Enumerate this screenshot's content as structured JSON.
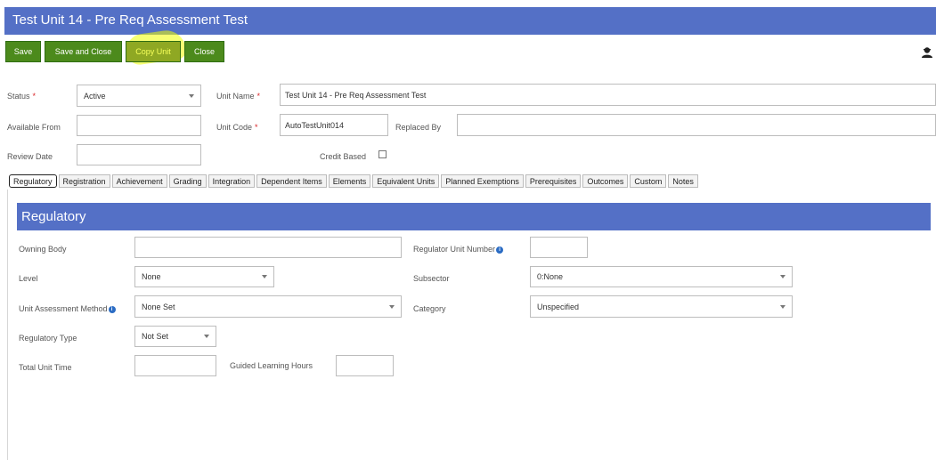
{
  "window": {
    "title": "Test Unit 14 - Pre Req Assessment Test"
  },
  "toolbar": {
    "save": "Save",
    "save_and_close": "Save and Close",
    "copy_unit": "Copy Unit",
    "close": "Close"
  },
  "header_form": {
    "status_label": "Status",
    "status_value": "Active",
    "unit_name_label": "Unit Name",
    "unit_name_value": "Test Unit 14 - Pre Req Assessment Test",
    "available_from_label": "Available From",
    "available_from_value": "",
    "unit_code_label": "Unit Code",
    "unit_code_value": "AutoTestUnit014",
    "replaced_by_label": "Replaced By",
    "replaced_by_value": "",
    "review_date_label": "Review Date",
    "review_date_value": "",
    "credit_based_label": "Credit Based",
    "credit_based_checked": false,
    "required_marker": "*"
  },
  "tabs": [
    {
      "label": "Regulatory",
      "active": true
    },
    {
      "label": "Registration"
    },
    {
      "label": "Achievement"
    },
    {
      "label": "Grading"
    },
    {
      "label": "Integration"
    },
    {
      "label": "Dependent Items"
    },
    {
      "label": "Elements"
    },
    {
      "label": "Equivalent Units"
    },
    {
      "label": "Planned Exemptions"
    },
    {
      "label": "Prerequisites"
    },
    {
      "label": "Outcomes"
    },
    {
      "label": "Custom"
    },
    {
      "label": "Notes"
    }
  ],
  "regulatory": {
    "title": "Regulatory",
    "owning_body_label": "Owning Body",
    "owning_body_value": "",
    "regulator_unit_number_label": "Regulator Unit Number",
    "regulator_unit_number_value": "",
    "level_label": "Level",
    "level_value": "None",
    "subsector_label": "Subsector",
    "subsector_value": "0:None",
    "unit_assessment_method_label": "Unit Assessment Method",
    "unit_assessment_method_value": "None Set",
    "category_label": "Category",
    "category_value": "Unspecified",
    "regulatory_type_label": "Regulatory Type",
    "regulatory_type_value": "Not Set",
    "total_unit_time_label": "Total Unit Time",
    "total_unit_time_value": "",
    "guided_learning_hours_label": "Guided Learning Hours",
    "guided_learning_hours_value": ""
  },
  "icons": {
    "user": "user-icon",
    "info": "info-icon",
    "dropdown": "chevron-down-icon"
  },
  "colors": {
    "header_blue": "#5470c6",
    "button_green": "#4c8a1c",
    "highlight": "#f0ff00"
  }
}
